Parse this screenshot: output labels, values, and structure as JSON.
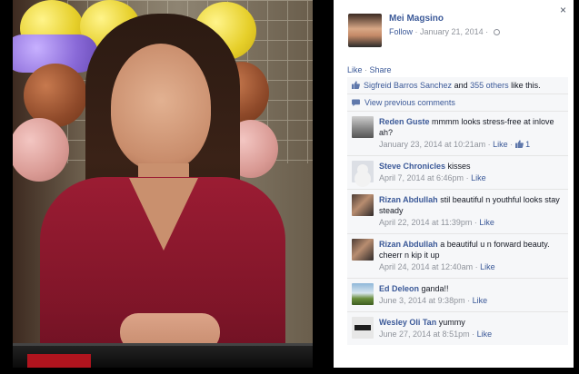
{
  "post": {
    "author": "Mei Magsino",
    "follow_label": "Follow",
    "date": "January 21, 2014",
    "close_glyph": "×"
  },
  "actions": {
    "like": "Like",
    "share": "Share"
  },
  "likes": {
    "liker": "Sigfreid Barros Sanchez",
    "and": "and",
    "others": "355 others",
    "suffix": "like this."
  },
  "view_previous": "View previous comments",
  "comments": [
    {
      "name": "Reden Guste",
      "text": "mmmm looks stress-free at inlove ah?",
      "time": "January 23, 2014 at 10:21am",
      "like": "Like",
      "like_count": "1"
    },
    {
      "name": "Steve Chronicles",
      "text": "kisses",
      "time": "April 7, 2014 at 6:46pm",
      "like": "Like"
    },
    {
      "name": "Rizan Abdullah",
      "text": "stil beautiful n youthful looks stay steady",
      "time": "April 22, 2014 at 11:39pm",
      "like": "Like"
    },
    {
      "name": "Rizan Abdullah",
      "text": "a beautiful u n forward beauty. cheerr n kip it up",
      "time": "April 24, 2014 at 12:40am",
      "like": "Like"
    },
    {
      "name": "Ed Deleon",
      "text": "ganda!!",
      "time": "June 3, 2014 at 9:38pm",
      "like": "Like"
    },
    {
      "name": "Wesley Oli Tan",
      "text": "yummy",
      "time": "June 27, 2014 at 8:51pm",
      "like": "Like"
    }
  ],
  "colors": {
    "link": "#3b5998",
    "meta": "#90949c",
    "panel_bg": "#f6f7f9"
  }
}
